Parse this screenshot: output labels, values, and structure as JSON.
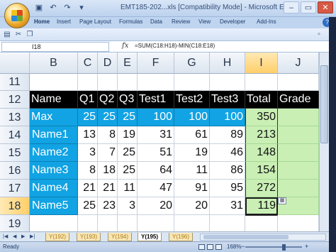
{
  "window": {
    "title": "EMT185-202...xls  [Compatibility Mode] - Microsoft Excel",
    "controls": [
      "–",
      "▭",
      "✕"
    ]
  },
  "ribbon_tabs": [
    "Home",
    "Insert",
    "Page Layout",
    "Formulas",
    "Data",
    "Review",
    "View",
    "Developer",
    "Add-Ins"
  ],
  "active_ribbon_tab": "Home",
  "formula_bar": {
    "name_box": "I18",
    "fx": "fx",
    "formula": "=SUM(C18:H18)-MIN(C18:E18)"
  },
  "columns": [
    "B",
    "C",
    "D",
    "E",
    "F",
    "G",
    "H",
    "I",
    "J"
  ],
  "selected_column": "I",
  "rows": [
    "11",
    "12",
    "13",
    "14",
    "15",
    "16",
    "17",
    "18",
    "19"
  ],
  "selected_row": "18",
  "table": {
    "headers": [
      "Name",
      "Q1",
      "Q2",
      "Q3",
      "Test1",
      "Test2",
      "Test3",
      "Total",
      "Grade"
    ],
    "max_row": [
      "Max",
      "25",
      "25",
      "25",
      "100",
      "100",
      "100",
      "350",
      ""
    ],
    "data_rows": [
      [
        "Name1",
        "13",
        "8",
        "19",
        "31",
        "61",
        "89",
        "213",
        ""
      ],
      [
        "Name2",
        "3",
        "7",
        "25",
        "51",
        "19",
        "46",
        "148",
        ""
      ],
      [
        "Name3",
        "8",
        "18",
        "25",
        "64",
        "11",
        "86",
        "154",
        ""
      ],
      [
        "Name4",
        "21",
        "21",
        "11",
        "47",
        "91",
        "95",
        "272",
        ""
      ],
      [
        "Name5",
        "25",
        "23",
        "3",
        "20",
        "20",
        "31",
        "119",
        ""
      ]
    ]
  },
  "sheet_tabs": [
    "Y(192)",
    "Y(193)",
    "Y(194)",
    "Y(195)",
    "Y(196)"
  ],
  "active_sheet_tab": "Y(195)",
  "status": {
    "ready": "Ready",
    "zoom": "168%"
  },
  "colors": {
    "header_row": "#000000",
    "accent_blue": "#11a3e3",
    "total_green": "#c9efb4"
  }
}
